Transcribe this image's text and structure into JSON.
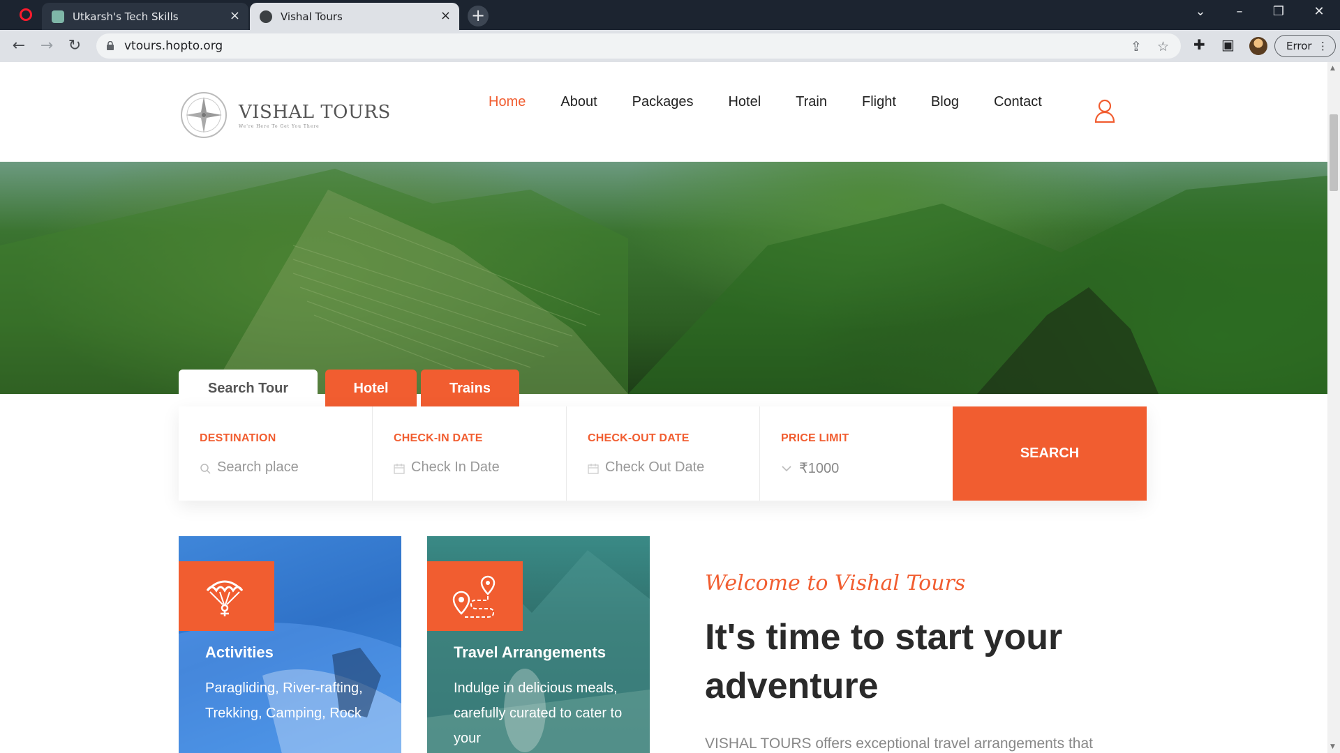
{
  "browser": {
    "tabs": [
      {
        "title": "Utkarsh's Tech Skills"
      },
      {
        "title": "Vishal Tours"
      }
    ],
    "url": "vtours.hopto.org",
    "profile_status": "Error"
  },
  "site": {
    "logo_title": "VISHAL TOURS",
    "logo_tagline": "We're Here To Get You There",
    "nav": [
      "Home",
      "About",
      "Packages",
      "Hotel",
      "Train",
      "Flight",
      "Blog",
      "Contact"
    ],
    "active_nav": "Home"
  },
  "search": {
    "tabs": [
      "Search Tour",
      "Hotel",
      "Trains"
    ],
    "fields": [
      {
        "label": "DESTINATION",
        "placeholder": "Search place",
        "icon": "search-icon"
      },
      {
        "label": "CHECK-IN DATE",
        "placeholder": "Check In Date",
        "icon": "calendar-icon"
      },
      {
        "label": "CHECK-OUT DATE",
        "placeholder": "Check Out Date",
        "icon": "calendar-icon"
      },
      {
        "label": "PRICE LIMIT",
        "value": "₹1000",
        "icon": "chevron-down-icon"
      }
    ],
    "button": "SEARCH"
  },
  "cards": [
    {
      "title": "Activities",
      "description": "Paragliding, River-rafting, Trekking, Camping, Rock",
      "icon": "paraglider-icon"
    },
    {
      "title": "Travel Arrangements",
      "description": "Indulge in delicious meals, carefully curated to cater to your",
      "icon": "route-pin-icon"
    }
  ],
  "about": {
    "script_heading": "Welcome to Vishal Tours",
    "headline": "It's time to start your adventure",
    "intro": "VISHAL TOURS offers exceptional travel arrangements that"
  },
  "colors": {
    "accent": "#f15d30",
    "chrome_dark": "#1c2430",
    "chrome_light": "#dee1e6"
  }
}
